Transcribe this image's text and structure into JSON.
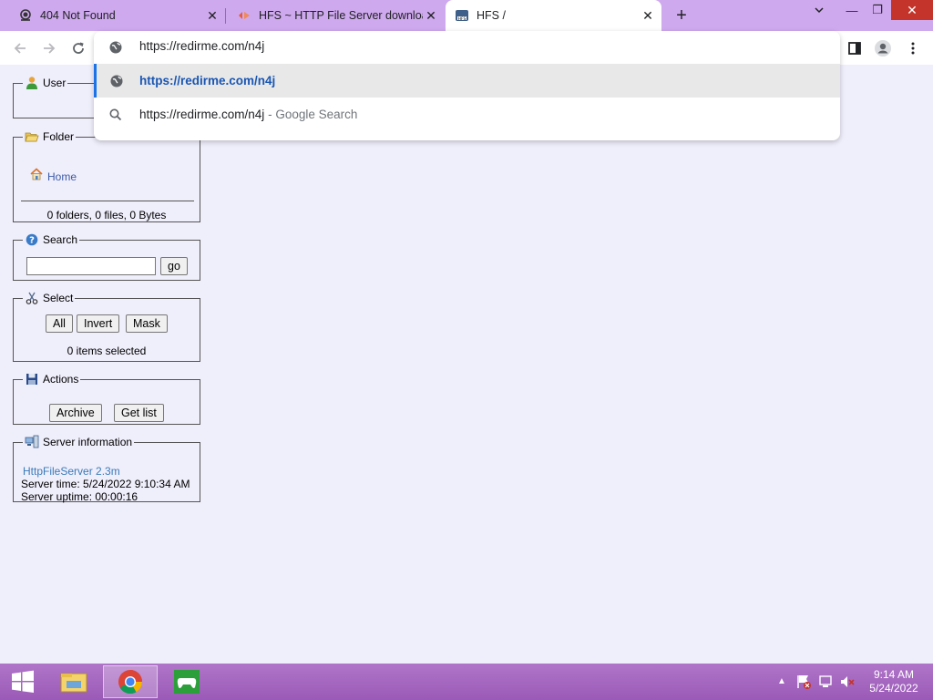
{
  "tabs": [
    {
      "title": "404 Not Found",
      "icon": "support-agent-icon"
    },
    {
      "title": "HFS ~ HTTP File Server download",
      "icon": "hfs-logo-icon"
    },
    {
      "title": "HFS /",
      "icon": "hfs-page-icon"
    }
  ],
  "omnibox": {
    "value": "https://redirme.com/n4j",
    "suggestions": [
      {
        "text": "https://redirme.com/n4j",
        "icon": "globe-icon"
      },
      {
        "text": "https://redirme.com/n4j",
        "separator": " - ",
        "sub": "Google Search",
        "icon": "search-icon"
      }
    ]
  },
  "sidebar": {
    "user": {
      "legend": "User"
    },
    "folder": {
      "legend": "Folder",
      "home_label": "Home",
      "stats": "0 folders, 0 files, 0 Bytes"
    },
    "search": {
      "legend": "Search",
      "go_label": "go",
      "value": ""
    },
    "select": {
      "legend": "Select",
      "all_label": "All",
      "invert_label": "Invert",
      "mask_label": "Mask",
      "status": "0 items selected"
    },
    "actions": {
      "legend": "Actions",
      "archive_label": "Archive",
      "getlist_label": "Get list"
    },
    "server": {
      "legend": "Server information",
      "version": "HttpFileServer 2.3m",
      "time": "Server time: 5/24/2022 9:10:34 AM",
      "uptime": "Server uptime: 00:00:16"
    }
  },
  "taskbar": {
    "time": "9:14 AM",
    "date": "5/24/2022"
  },
  "colors": {
    "tabstrip": "#cfa9ee",
    "page_bg": "#efeefb",
    "accent": "#1a73e8",
    "close_red": "#c4342b"
  }
}
